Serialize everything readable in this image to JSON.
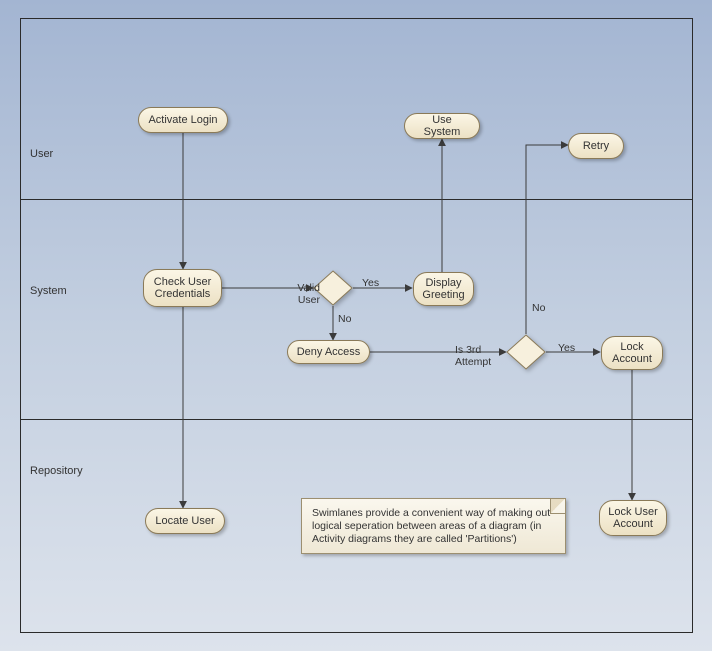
{
  "diagram_type": "UML Activity Diagram (Swimlanes)",
  "lanes": {
    "user": "User",
    "system": "System",
    "repository": "Repository"
  },
  "activities": {
    "activate_login": "Activate Login",
    "use_system": "Use System",
    "retry": "Retry",
    "check_credentials": "Check User\nCredentials",
    "display_greeting": "Display\nGreeting",
    "deny_access": "Deny Access",
    "lock_account": "Lock\nAccount",
    "locate_user": "Locate User",
    "lock_user_account": "Lock User\nAccount"
  },
  "decisions": {
    "valid_user": {
      "label": "Valid\nUser",
      "yes": "Yes",
      "no": "No"
    },
    "is_3rd_attempt": {
      "label": "Is 3rd\nAttempt",
      "yes": "Yes",
      "no": "No"
    }
  },
  "note": "Swimlanes provide a convenient way of making out logical seperation between areas of a diagram (in Activity diagrams they are called 'Partitions')",
  "chart_data": {
    "type": "table",
    "partitions": [
      "User",
      "System",
      "Repository"
    ],
    "nodes": [
      {
        "id": "activate_login",
        "type": "activity",
        "lane": "User",
        "label": "Activate Login"
      },
      {
        "id": "use_system",
        "type": "activity",
        "lane": "User",
        "label": "Use System"
      },
      {
        "id": "retry",
        "type": "activity",
        "lane": "User",
        "label": "Retry"
      },
      {
        "id": "check_credentials",
        "type": "activity",
        "lane": "System",
        "label": "Check User Credentials"
      },
      {
        "id": "valid_user",
        "type": "decision",
        "lane": "System",
        "label": "Valid User"
      },
      {
        "id": "display_greeting",
        "type": "activity",
        "lane": "System",
        "label": "Display Greeting"
      },
      {
        "id": "deny_access",
        "type": "activity",
        "lane": "System",
        "label": "Deny Access"
      },
      {
        "id": "is_3rd_attempt",
        "type": "decision",
        "lane": "System",
        "label": "Is 3rd Attempt"
      },
      {
        "id": "lock_account",
        "type": "activity",
        "lane": "System",
        "label": "Lock Account"
      },
      {
        "id": "locate_user",
        "type": "activity",
        "lane": "Repository",
        "label": "Locate User"
      },
      {
        "id": "lock_user_account",
        "type": "activity",
        "lane": "Repository",
        "label": "Lock User Account"
      }
    ],
    "edges": [
      {
        "from": "activate_login",
        "to": "check_credentials"
      },
      {
        "from": "check_credentials",
        "to": "valid_user"
      },
      {
        "from": "check_credentials",
        "to": "locate_user"
      },
      {
        "from": "valid_user",
        "to": "display_greeting",
        "label": "Yes"
      },
      {
        "from": "valid_user",
        "to": "deny_access",
        "label": "No"
      },
      {
        "from": "display_greeting",
        "to": "use_system"
      },
      {
        "from": "deny_access",
        "to": "is_3rd_attempt"
      },
      {
        "from": "is_3rd_attempt",
        "to": "lock_account",
        "label": "Yes"
      },
      {
        "from": "is_3rd_attempt",
        "to": "retry",
        "label": "No"
      },
      {
        "from": "lock_account",
        "to": "lock_user_account"
      }
    ],
    "note": "Swimlanes provide a convenient way of making out logical seperation between areas of a diagram (in Activity diagrams they are called 'Partitions')"
  }
}
